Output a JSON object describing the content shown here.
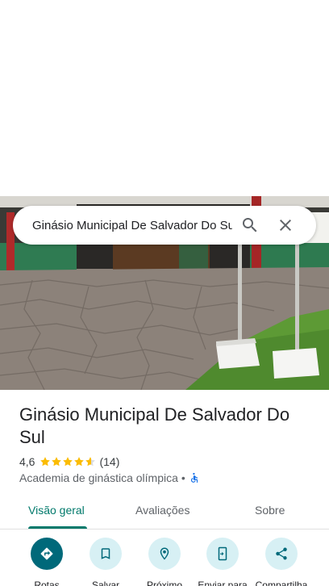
{
  "search": {
    "query": "Ginásio Municipal De Salvador Do Sul"
  },
  "place": {
    "name": "Ginásio Municipal De Salvador Do Sul",
    "rating": "4,6",
    "rating_value": 4.6,
    "review_count": "(14)",
    "category": "Academia de ginástica olímpica",
    "separator": "•"
  },
  "tabs": [
    {
      "label": "Visão geral",
      "active": true
    },
    {
      "label": "Avaliações",
      "active": false
    },
    {
      "label": "Sobre",
      "active": false
    }
  ],
  "actions": [
    {
      "label": "Rotas",
      "icon": "directions-icon",
      "primary": true
    },
    {
      "label": "Salvar",
      "icon": "bookmark-icon",
      "primary": false
    },
    {
      "label": "Próximo",
      "icon": "nearby-icon",
      "primary": false
    },
    {
      "label": "Enviar para",
      "icon": "send-to-phone-icon",
      "primary": false
    },
    {
      "label": "Compartilha",
      "icon": "share-icon",
      "primary": false
    }
  ],
  "colors": {
    "accent": "#00796b",
    "star": "#fbbc04",
    "action_bg": "#d7f0f4",
    "action_primary": "#00697a"
  }
}
